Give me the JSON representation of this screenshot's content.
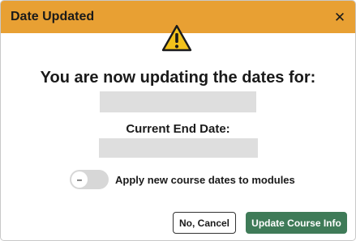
{
  "dialog": {
    "title": "Date Updated",
    "close_glyph": "✕",
    "warning_icon": "warning-triangle-icon",
    "heading": "You are now updating the dates for:",
    "current_end_date_label": "Current End Date:",
    "toggle": {
      "label": "Apply new course dates to modules",
      "state": "off",
      "knob_glyph": "–"
    },
    "buttons": {
      "cancel": "No, Cancel",
      "update": "Update Course Info"
    }
  },
  "colors": {
    "header_bg": "#e8a033",
    "primary_button": "#3f7b58",
    "warning_yellow": "#f2c21b"
  }
}
